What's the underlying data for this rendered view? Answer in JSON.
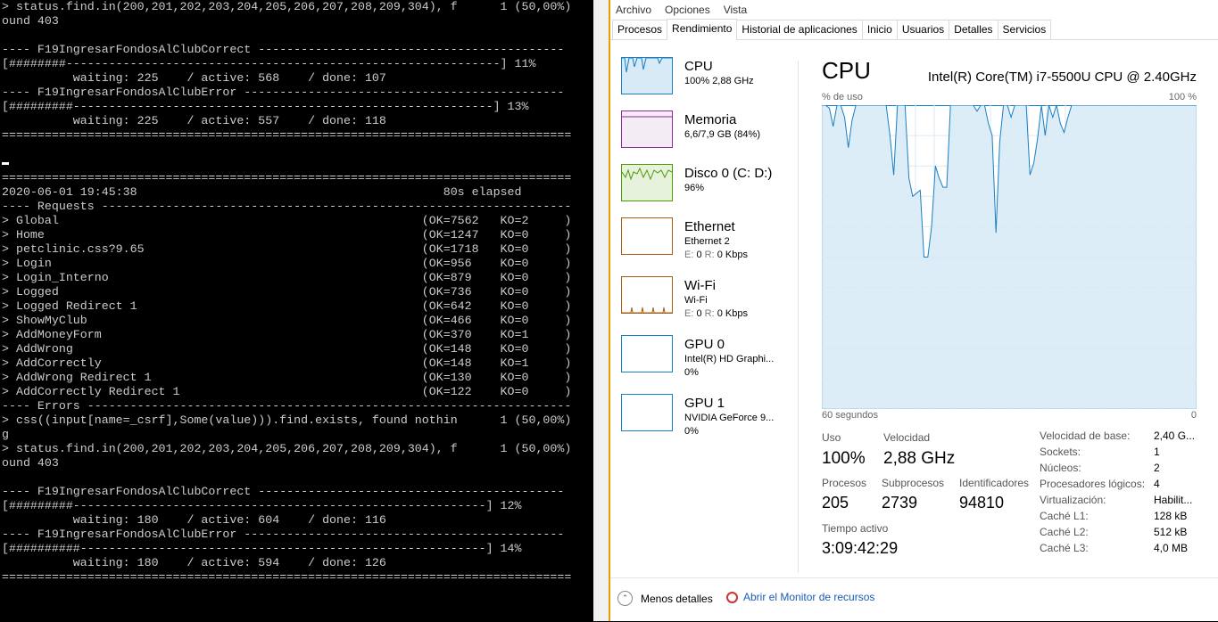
{
  "console": {
    "lines": [
      "> status.find.in(200,201,202,203,204,205,206,207,208,209,304), f      1 (50,00%)",
      "ound 403",
      "",
      "---- F19IngresarFondosAlClubCorrect -------------------------------------------",
      "[########-------------------------------------------------------------] 11%",
      "          waiting: 225    / active: 568    / done: 107",
      "---- F19IngresarFondosAlClubError ---------------------------------------------",
      "[#########-----------------------------------------------------------] 13%",
      "          waiting: 225    / active: 557    / done: 118",
      "================================================================================",
      "",
      "",
      "================================================================================",
      "2020-06-01 19:45:38                                           80s elapsed",
      "---- Requests ------------------------------------------------------------------",
      "> Global                                                   (OK=7562   KO=2     )",
      "> Home                                                     (OK=1247   KO=0     )",
      "> petclinic.css?9.65                                       (OK=1718   KO=0     )",
      "> Login                                                    (OK=956    KO=0     )",
      "> Login_Interno                                            (OK=879    KO=0     )",
      "> Logged                                                   (OK=736    KO=0     )",
      "> Logged Redirect 1                                        (OK=642    KO=0     )",
      "> ShowMyClub                                               (OK=466    KO=0     )",
      "> AddMoneyForm                                             (OK=370    KO=1     )",
      "> AddWrong                                                 (OK=148    KO=0     )",
      "> AddCorrectly                                             (OK=148    KO=1     )",
      "> AddWrong Redirect 1                                      (OK=130    KO=0     )",
      "> AddCorrectly Redirect 1                                  (OK=122    KO=0     )",
      "---- Errors --------------------------------------------------------------------",
      "> css((input[name=_csrf],Some(value))).find.exists, found nothin      1 (50,00%)",
      "g",
      "> status.find.in(200,201,202,203,204,205,206,207,208,209,304), f      1 (50,00%)",
      "ound 403",
      "",
      "---- F19IngresarFondosAlClubCorrect -------------------------------------------",
      "[#########----------------------------------------------------------] 12%",
      "          waiting: 180    / active: 604    / done: 116",
      "---- F19IngresarFondosAlClubError ---------------------------------------------",
      "[##########---------------------------------------------------------] 14%",
      "          waiting: 180    / active: 594    / done: 126",
      "================================================================================"
    ]
  },
  "taskmanager": {
    "menu": [
      "Archivo",
      "Opciones",
      "Vista"
    ],
    "tabs": [
      "Procesos",
      "Rendimiento",
      "Historial de aplicaciones",
      "Inicio",
      "Usuarios",
      "Detalles",
      "Servicios"
    ],
    "active_tab": "Rendimiento",
    "sidebar": [
      {
        "name": "CPU",
        "sub": "100% 2,88 GHz",
        "sub2": "",
        "color": "#1a7fc2",
        "fill": "#d7eaf6"
      },
      {
        "name": "Memoria",
        "sub": "6,6/7,9 GB (84%)",
        "sub2": "",
        "color": "#8b2c99",
        "fill": "#f4ecf5"
      },
      {
        "name": "Disco 0 (C: D:)",
        "sub": "96%",
        "sub2": "",
        "color": "#4e9a06",
        "fill": "#e6f2dc"
      },
      {
        "name": "Ethernet",
        "sub": "Ethernet 2",
        "sub2_label_e": "E:",
        "sub2_e": "0",
        "sub2_label_r": "R:",
        "sub2_r": "0 Kbps",
        "color": "#a75c15",
        "fill": "#ffffff"
      },
      {
        "name": "Wi-Fi",
        "sub": "Wi-Fi",
        "sub2_label_e": "E:",
        "sub2_e": "0",
        "sub2_label_r": "R:",
        "sub2_r": "0 Kbps",
        "color": "#a75c15",
        "fill": "#ffffff"
      },
      {
        "name": "GPU 0",
        "sub": "Intel(R) HD Graphi...",
        "sub2": "0%",
        "color": "#1a7fc2",
        "fill": "#ffffff"
      },
      {
        "name": "GPU 1",
        "sub": "NVIDIA GeForce 9...",
        "sub2": "0%",
        "color": "#1a7fc2",
        "fill": "#ffffff"
      }
    ],
    "main": {
      "title": "CPU",
      "model": "Intel(R) Core(TM) i7-5500U CPU @ 2.40GHz",
      "y_label": "% de uso",
      "y_max": "100 %",
      "x_left": "60 segundos",
      "x_right": "0",
      "line_color": "#1a7fc2",
      "fill_color": "#d7eaf6",
      "usage_series": [
        100,
        100,
        99,
        93,
        100,
        100,
        96,
        86,
        95,
        100,
        100,
        100,
        100,
        100,
        100,
        100,
        100,
        100,
        90,
        77,
        100,
        100,
        100,
        76,
        70,
        71,
        72,
        50,
        50,
        60,
        80,
        76,
        73,
        73,
        100,
        100,
        100,
        100,
        100,
        100,
        100,
        98,
        100,
        100,
        94,
        90,
        58,
        88,
        100,
        100,
        96,
        100,
        100,
        100,
        100,
        77,
        81,
        89,
        100,
        90,
        100,
        96,
        100,
        94,
        91,
        96,
        100,
        100,
        100,
        100,
        100,
        100,
        100,
        100,
        100,
        100,
        100,
        100,
        100,
        100,
        100,
        100,
        100,
        100,
        100,
        100,
        100,
        100,
        100,
        100,
        100,
        100,
        100,
        100,
        100,
        100,
        100,
        100,
        100,
        100
      ],
      "stats": {
        "uso_label": "Uso",
        "uso": "100%",
        "velocidad_label": "Velocidad",
        "velocidad": "2,88 GHz",
        "procesos_label": "Procesos",
        "procesos": "205",
        "subprocesos_label": "Subprocesos",
        "subprocesos": "2739",
        "identificadores_label": "Identificadores",
        "identificadores": "94810",
        "tiempo_label": "Tiempo activo",
        "tiempo": "3:09:42:29"
      },
      "details": [
        {
          "k": "Velocidad de base:",
          "v": "2,40 G..."
        },
        {
          "k": "Sockets:",
          "v": "1"
        },
        {
          "k": "Núcleos:",
          "v": "2"
        },
        {
          "k": "Procesadores lógicos:",
          "v": "4"
        },
        {
          "k": "Virtualización:",
          "v": "Habilit..."
        },
        {
          "k": "Caché L1:",
          "v": "128 kB"
        },
        {
          "k": "Caché L2:",
          "v": "512 kB"
        },
        {
          "k": "Caché L3:",
          "v": "4,0 MB"
        }
      ]
    },
    "footer": {
      "less_details": "Menos detalles",
      "monitor": "Abrir el Monitor de recursos"
    }
  }
}
